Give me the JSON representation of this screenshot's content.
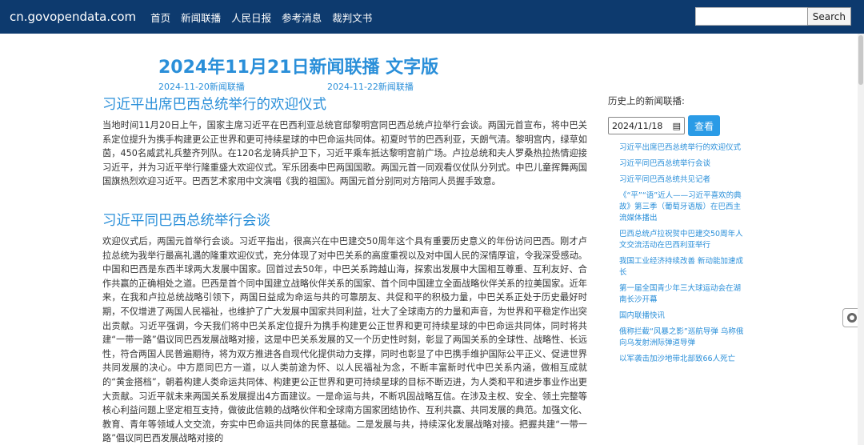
{
  "navbar": {
    "brand": "cn.govopendata.com",
    "links": [
      "首页",
      "新闻联播",
      "人民日报",
      "参考消息",
      "裁判文书"
    ],
    "search_placeholder": "",
    "search_label": "Search"
  },
  "main": {
    "title": "2024年11月21日新闻联播 文字版",
    "prev_link": "2024-11-20新闻联播",
    "next_link": "2024-11-22新闻联播",
    "articles": [
      {
        "title": "习近平出席巴西总统举行的欢迎仪式",
        "body": "当地时间11月20日上午，国家主席习近平在巴西利亚总统官邸黎明宫同巴西总统卢拉举行会谈。两国元首宣布，将中巴关系定位提升为携手构建更公正世界和更可持续星球的中巴命运共同体。初夏时节的巴西利亚，天朗气清。黎明宫内，绿草如茵，450名威武礼兵整齐列队。在120名龙骑兵护卫下，习近平乘车抵达黎明宫前广场。卢拉总统和夫人罗桑热拉热情迎接习近平，并为习近平举行隆重盛大欢迎仪式。军乐团奏中巴两国国歌。两国元首一同观看仪仗队分列式。中巴儿童挥舞两国国旗热烈欢迎习近平。巴西艺术家用中文演唱《我的祖国》。两国元首分别同对方陪同人员握手致意。"
      },
      {
        "title": "习近平同巴西总统举行会谈",
        "body": "欢迎仪式后，两国元首举行会谈。习近平指出，很高兴在中巴建交50周年这个具有重要历史意义的年份访问巴西。刚才卢拉总统为我举行最高礼遇的隆重欢迎仪式，充分体现了对中巴关系的高度重视以及对中国人民的深情厚谊，令我深受感动。中国和巴西是东西半球两大发展中国家。回首过去50年，中巴关系跨越山海，探索出发展中大国相互尊重、互利友好、合作共赢的正确相处之道。巴西是首个同中国建立战略伙伴关系的国家、首个同中国建立全面战略伙伴关系的拉美国家。近年来，在我和卢拉总统战略引领下，两国日益成为命运与共的可靠朋友、共促和平的积极力量，中巴关系正处于历史最好时期，不仅增进了两国人民福祉，也维护了广大发展中国家共同利益，壮大了全球南方的力量和声音，为世界和平稳定作出突出贡献。习近平强调，今天我们将中巴关系定位提升为携手构建更公正世界和更可持续星球的中巴命运共同体，同时将共建“一带一路”倡议同巴西发展战略对接，这是中巴关系发展的又一个历史性时刻，彰显了两国关系的全球性、战略性、长远性，符合两国人民普遍期待，将为双方推进各自现代化提供动力支撑，同时也彰显了中巴携手维护国际公平正义、促进世界共同发展的决心。中方愿同巴方一道，以人类前途为怀、以人民福祉为念，不断丰富新时代中巴关系内涵，做相互成就的“黄金搭档”，朝着构建人类命运共同体、构建更公正世界和更可持续星球的目标不断迈进，为人类和平和进步事业作出更大贡献。习近平就未来两国关系发展提出4方面建议。一是命运与共，不断巩固战略互信。在涉及主权、安全、领土完整等核心利益问题上坚定相互支持，做彼此信赖的战略伙伴和全球南方国家团结协作、互利共赢、共同发展的典范。加强文化、教育、青年等领域人文交流，夯实中巴命运共同体的民意基础。二是发展与共，持续深化发展战略对接。把握共建“一带一路”倡议同巴西发展战略对接的"
      }
    ]
  },
  "sidebar": {
    "heading": "历史上的新闻联播:",
    "date_value": "2024/11/18",
    "query_label": "查看",
    "items": [
      "习近平出席巴西总统举行的欢迎仪式",
      "习近平同巴西总统举行会谈",
      "习近平同巴西总统共见记者",
      "《“平”“语”近人——习近平喜欢的典故》第三季（葡萄牙语版）在巴西主流媒体播出",
      "巴西总统卢拉祝贺中巴建交50周年人文交流活动在巴西利亚举行",
      "我国工业经济持续改善 新动能加速成长",
      "第一届全国青少年三大球运动会在湖南长沙开幕",
      "国内联播快讯",
      "俄称拦截“风暴之影”巡航导弹 乌称俄向乌发射洲际弹道导弹",
      "以军袭击加沙地带北部致66人死亡"
    ]
  }
}
